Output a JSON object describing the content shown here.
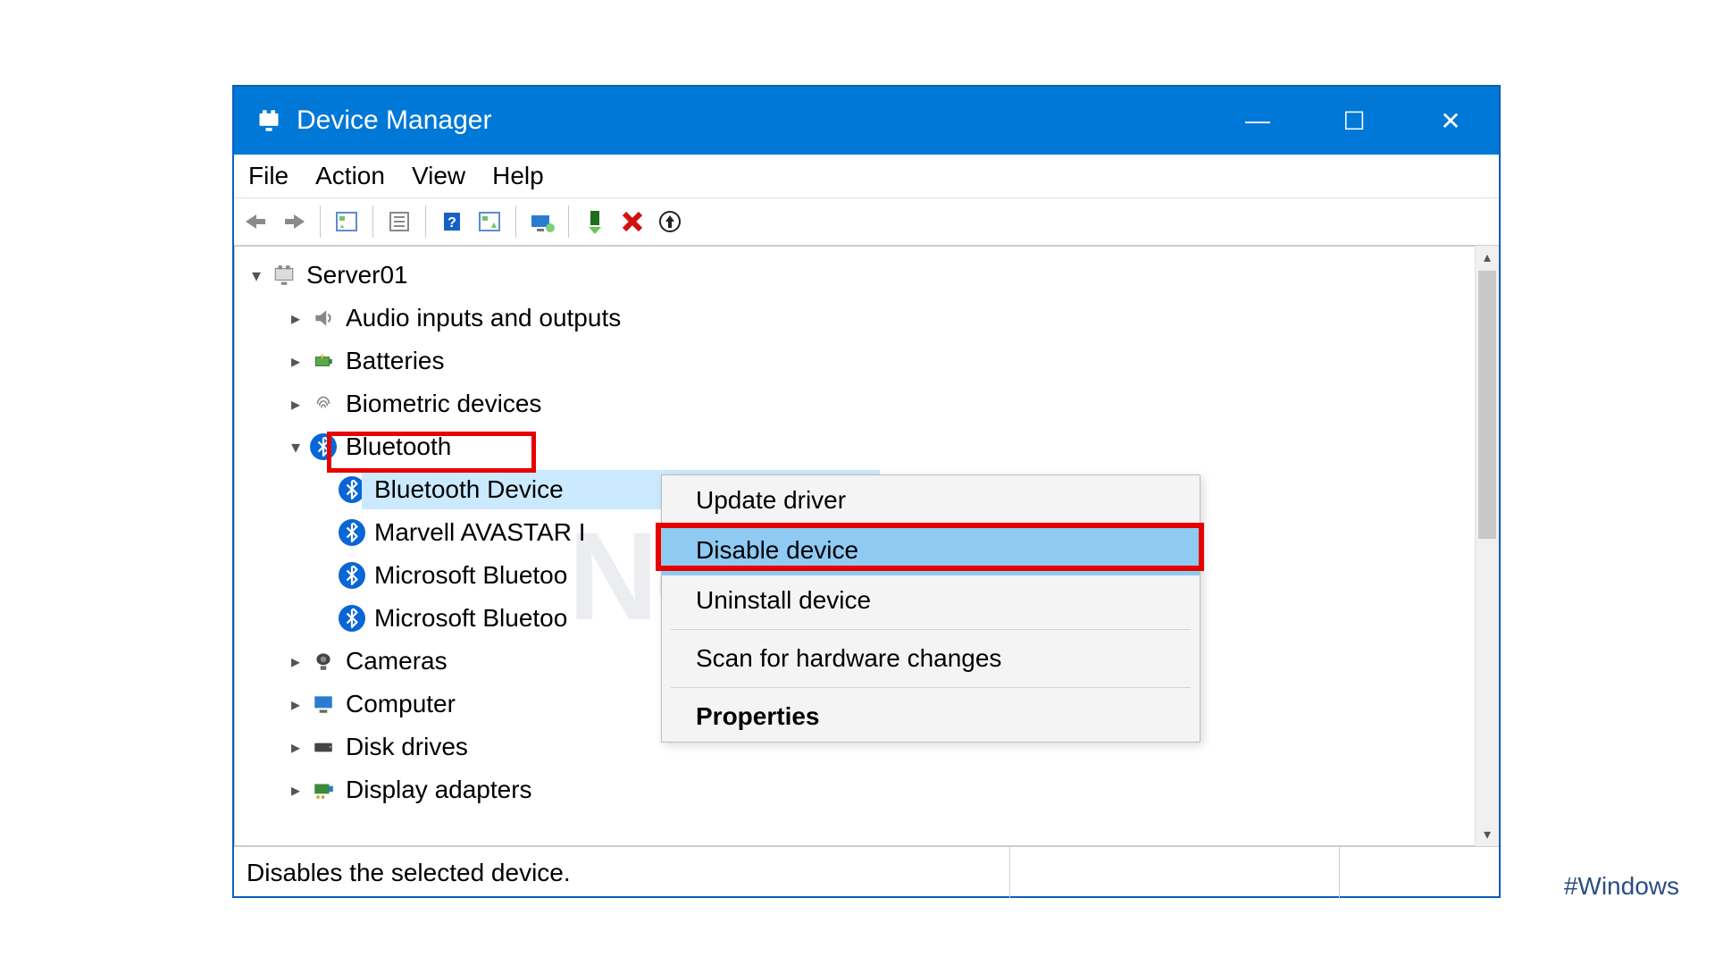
{
  "title": "Device Manager",
  "window_controls": {
    "min": "—",
    "max": "☐",
    "close": "✕"
  },
  "menu": {
    "file": "File",
    "action": "Action",
    "view": "View",
    "help": "Help"
  },
  "tree": {
    "root": "Server01",
    "categories": [
      {
        "label": "Audio inputs and outputs"
      },
      {
        "label": "Batteries"
      },
      {
        "label": "Biometric devices"
      },
      {
        "label": "Bluetooth",
        "expanded": true,
        "children": [
          "Bluetooth Device",
          "Marvell AVASTAR I",
          "Microsoft Bluetoo",
          "Microsoft Bluetoo"
        ]
      },
      {
        "label": "Cameras"
      },
      {
        "label": "Computer"
      },
      {
        "label": "Disk drives"
      },
      {
        "label": "Display adapters"
      }
    ]
  },
  "context_menu": {
    "update": "Update driver",
    "disable": "Disable device",
    "uninstall": "Uninstall device",
    "scan": "Scan for hardware changes",
    "properties": "Properties"
  },
  "statusbar": "Disables the selected device.",
  "watermark": "NeuronVM",
  "hashtag": "#Windows"
}
